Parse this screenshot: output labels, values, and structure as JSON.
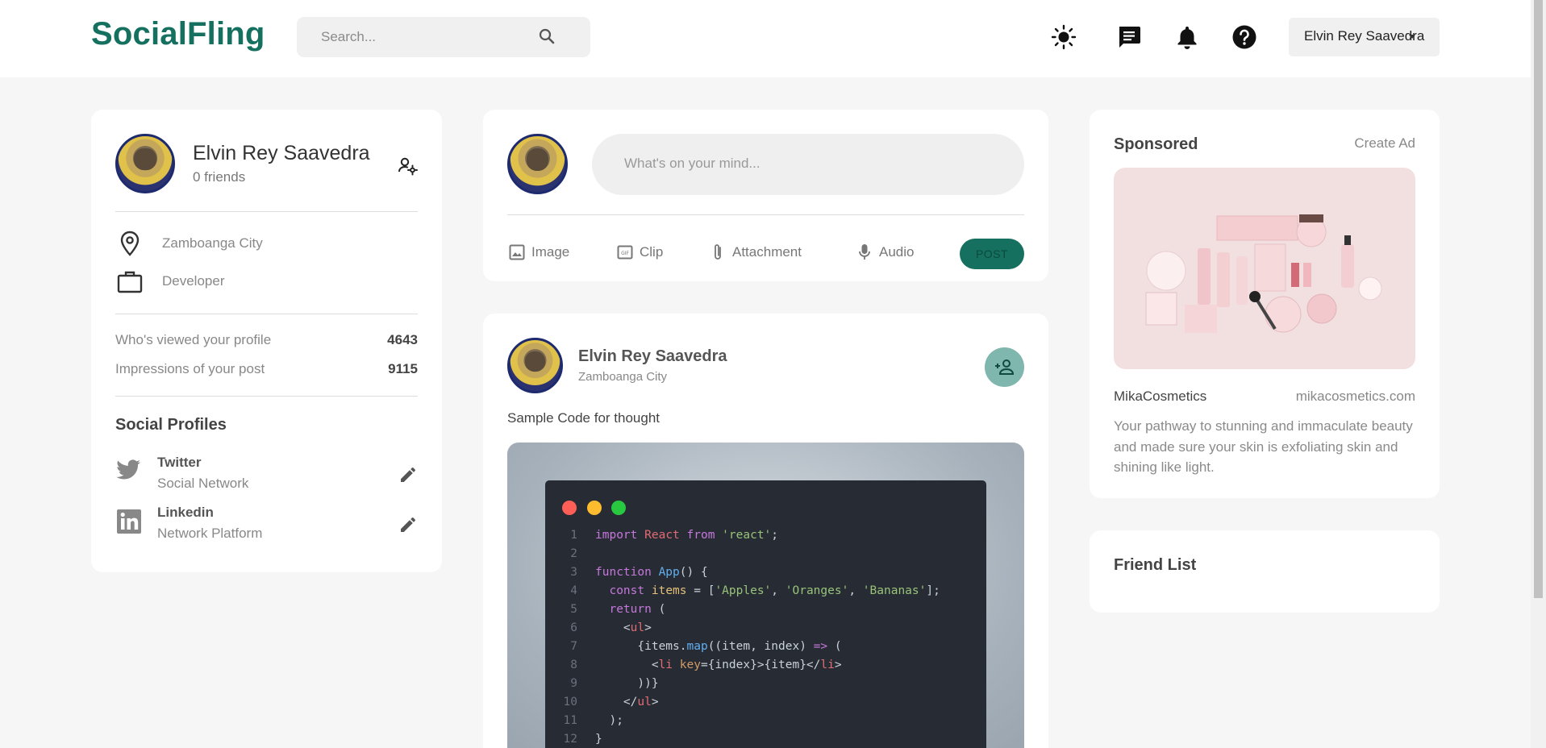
{
  "app": {
    "logo": "SocialFling",
    "search_placeholder": "Search...",
    "current_user": "Elvin Rey Saavedra"
  },
  "profile_card": {
    "name": "Elvin Rey Saavedra",
    "friends": "0 friends",
    "location": "Zamboanga City",
    "occupation": "Developer",
    "stats": [
      {
        "label": "Who's viewed your profile",
        "value": "4643"
      },
      {
        "label": "Impressions of your post",
        "value": "9115"
      }
    ],
    "social_title": "Social Profiles",
    "socials": [
      {
        "name": "Twitter",
        "sub": "Social Network"
      },
      {
        "name": "Linkedin",
        "sub": "Network Platform"
      }
    ]
  },
  "composer": {
    "placeholder": "What's on your mind...",
    "actions": [
      "Image",
      "Clip",
      "Attachment",
      "Audio"
    ],
    "post_label": "POST"
  },
  "post": {
    "author": "Elvin Rey Saavedra",
    "location": "Zamboanga City",
    "text": "Sample Code for thought",
    "code_lines": [
      "import React from 'react';",
      "",
      "function App() {",
      "  const items = ['Apples', 'Oranges', 'Bananas'];",
      "  return (",
      "    <ul>",
      "      {items.map((item, index) => (",
      "        <li key={index}>{item}</li>",
      "      ))}",
      "    </ul>",
      "  );",
      "}"
    ]
  },
  "sponsored": {
    "title": "Sponsored",
    "create_ad": "Create Ad",
    "brand": "MikaCosmetics",
    "site": "mikacosmetics.com",
    "description": "Your pathway to stunning and immaculate beauty and made sure your skin is exfoliating skin and shining like light."
  },
  "friend_list": {
    "title": "Friend List"
  },
  "colors": {
    "brand": "#15705f",
    "post_button": "#15705f",
    "add_friend_button": "#7fb6ad"
  }
}
